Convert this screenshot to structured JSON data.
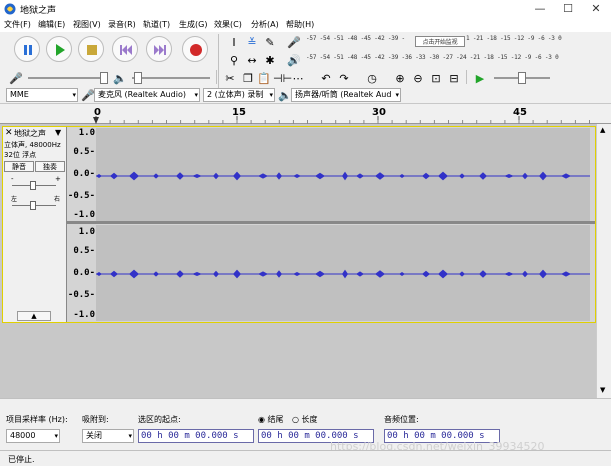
{
  "window": {
    "title": "地狱之声",
    "min": "—",
    "max": "☐",
    "close": "✕"
  },
  "menu": [
    "文件(F)",
    "编辑(E)",
    "视图(V)",
    "录音(R)",
    "轨道(T)",
    "生成(G)",
    "效果(C)",
    "分析(A)",
    "帮助(H)"
  ],
  "meter": {
    "rec_scale": "-57 -54 -51 -48 -45 -42 -39 -",
    "rec_click": "点击开始监视",
    "rec_scale2": "1 -21 -18 -15 -12  -9  -6  -3  0",
    "play_scale": "-57 -54 -51 -48 -45 -42 -39 -36 -33 -30 -27 -24 -21 -18 -15 -12  -9  -6  -3  0"
  },
  "devices": {
    "host": "MME",
    "input": "麦克风 (Realtek Audio)",
    "channels": "2 (立体声) 录制",
    "output": "扬声器/听筒 (Realtek Aud"
  },
  "ruler": {
    "ticks": [
      "0",
      "15",
      "30",
      "45"
    ]
  },
  "track": {
    "name": "地狱之声",
    "info1": "立体声, 48000Hz",
    "info2": "32位 浮点",
    "mute": "静音",
    "solo": "独奏",
    "gain_minus": "-",
    "gain_plus": "+",
    "pan_left": "左",
    "pan_right": "右",
    "scale": [
      "1.0",
      "0.5-",
      "0.0-",
      "-0.5-",
      "-1.0"
    ]
  },
  "selection": {
    "rate_label": "项目采样率 (Hz):",
    "rate_value": "48000",
    "snap_label": "吸附到:",
    "snap_value": "关闭",
    "start_label": "选区的起点:",
    "end_label": "结尾",
    "length_label": "长度",
    "pos_label": "音频位置:",
    "time_start": "00 h 00 m 00.000 s",
    "time_end": "00 h 00 m 00.000 s",
    "time_pos": "00 h 00 m 00.000 s"
  },
  "status": {
    "text": "已停止."
  },
  "watermark": "https://blog.csdn.net/weixin_39934520"
}
